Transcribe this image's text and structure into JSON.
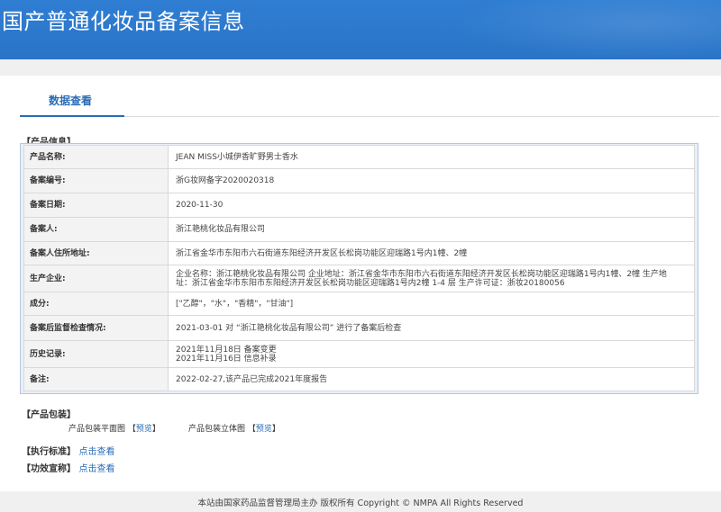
{
  "header": {
    "title": "国产普通化妆品备案信息"
  },
  "tab": {
    "label": "数据查看"
  },
  "product_info": {
    "section_title": "【产品信息】",
    "rows": [
      {
        "key": "产品名称:",
        "value": "JEAN MISS小城伊香旷野男士香水"
      },
      {
        "key": "备案编号:",
        "value": "浙G妆网备字2020020318"
      },
      {
        "key": "备案日期:",
        "value": "2020-11-30"
      },
      {
        "key": "备案人:",
        "value": "浙江艳桃化妆品有限公司"
      },
      {
        "key": "备案人住所地址:",
        "value": "浙江省金华市东阳市六石街道东阳经济开发区长松岗功能区迎瑞路1号内1幢、2幢"
      },
      {
        "key": "生产企业:",
        "line1": "企业名称：浙江艳桃化妆品有限公司 企业地址：浙江省金华市东阳市六石街道东阳经济开发区长松岗功能区迎瑞路1号内1幢、2幢 生产地",
        "line2": "址：浙江省金华市东阳市东阳经济开发区长松岗功能区迎瑞路1号内2幢 1-4 层 生产许可证：浙妆20180056"
      },
      {
        "key": "成分:",
        "value": "[\"乙醇\"，\"水\"，\"香精\"，\"甘油\"]"
      },
      {
        "key": "备案后监督检查情况:",
        "value": "2021-03-01 对 “浙江艳桃化妆品有限公司” 进行了备案后检查"
      },
      {
        "key": "历史记录:",
        "line1": "2021年11月18日 备案变更",
        "line2": "2021年11月16日 信息补录"
      },
      {
        "key": "备注:",
        "value": "2022-02-27,该产品已完成2021年度报告"
      }
    ]
  },
  "packaging": {
    "section_title": "【产品包装】",
    "flat_label": "产品包装平面图",
    "flat_link": "预览",
    "solid_label": "产品包装立体图",
    "solid_link": "预览",
    "bracket_open": "【",
    "bracket_close": "】"
  },
  "standard": {
    "section_title": "【执行标准】",
    "link": "点击查看"
  },
  "efficacy": {
    "section_title": "【功效宣称】",
    "link": "点击查看"
  },
  "footer": {
    "text": "本站由国家药品监督管理局主办 版权所有 Copyright © NMPA All Rights Reserved"
  }
}
